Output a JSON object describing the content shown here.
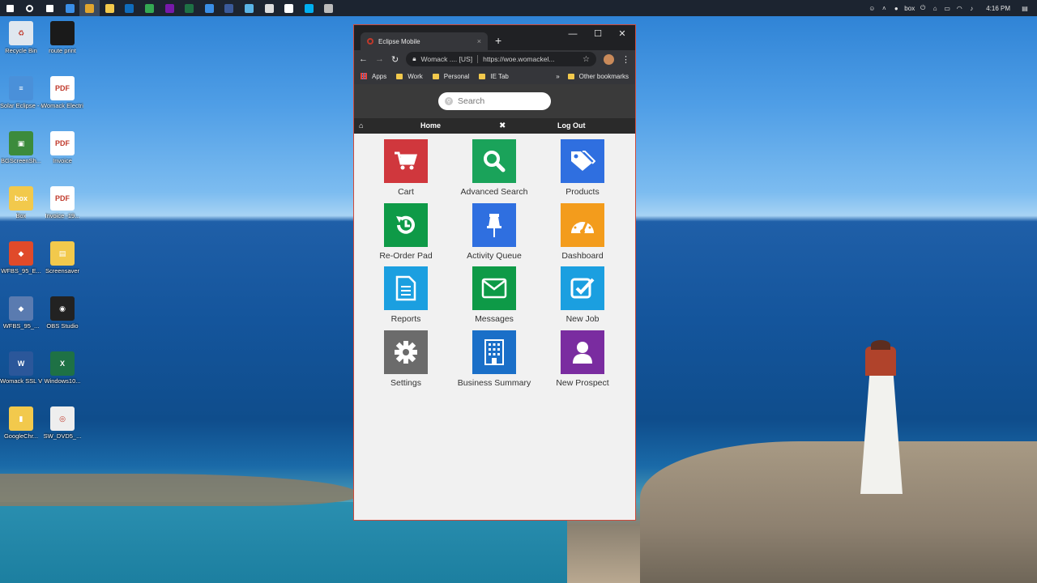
{
  "taskbar": {
    "apps": [
      {
        "icon": "windows-start-icon",
        "color": "#ffffff"
      },
      {
        "icon": "cortana-search-icon",
        "color": "#ffffff"
      },
      {
        "icon": "task-view-icon",
        "color": "#ffffff"
      },
      {
        "icon": "edge-icon",
        "color": "#3a8ee6"
      },
      {
        "icon": "chrome-icon",
        "color": "#e0a52d"
      },
      {
        "icon": "file-explorer-icon",
        "color": "#f2c94c"
      },
      {
        "icon": "outlook-icon",
        "color": "#0f6cbd"
      },
      {
        "icon": "chrome-alt-icon",
        "color": "#34a853"
      },
      {
        "icon": "onenote-icon",
        "color": "#7719aa"
      },
      {
        "icon": "excel-icon",
        "color": "#1e7145"
      },
      {
        "icon": "todo-icon",
        "color": "#3a8ee6"
      },
      {
        "icon": "app-icon",
        "color": "#3a5a9a"
      },
      {
        "icon": "app2-icon",
        "color": "#5ab4e6"
      },
      {
        "icon": "app3-icon",
        "color": "#dddddd"
      },
      {
        "icon": "app4-icon",
        "color": "#ffffff"
      },
      {
        "icon": "skype-icon",
        "color": "#00aff0"
      },
      {
        "icon": "clock-app-icon",
        "color": "#bbbbbb"
      }
    ],
    "tray_clock": "4:16 PM",
    "tray_box": "box"
  },
  "desktop": {
    "icons": [
      {
        "label": "Recycle Bin",
        "color": "#dfe7ef",
        "icon": "recycle-bin-icon"
      },
      {
        "label": "route print",
        "color": "#1a1a1a",
        "icon": "terminal-icon"
      },
      {
        "label": "Solar Eclipse - eclipse",
        "color": "#4a90d9",
        "icon": "eclipse-icon"
      },
      {
        "label": "Womack Electric - Tra...",
        "color": "#ffffff",
        "icon": "pdf-icon"
      },
      {
        "label": "BGScreenSh...",
        "color": "#3c8b3c",
        "icon": "monitor-icon"
      },
      {
        "label": "Invoice",
        "color": "#ffffff",
        "icon": "pdf-icon"
      },
      {
        "label": "Box",
        "color": "#f2c94c",
        "icon": "box-folder-icon"
      },
      {
        "label": "Invoice -19...",
        "color": "#ffffff",
        "icon": "pdf-icon"
      },
      {
        "label": "WFBS_95_E...",
        "color": "#e04a2a",
        "icon": "installer-icon"
      },
      {
        "label": "Screensaver",
        "color": "#f2c94c",
        "icon": "folder-icon"
      },
      {
        "label": "WFBS_95_...",
        "color": "#5a7bb0",
        "icon": "installer-icon"
      },
      {
        "label": "OBS Studio",
        "color": "#222222",
        "icon": "obs-icon"
      },
      {
        "label": "Womack SSL VPN for Users",
        "color": "#2b579a",
        "icon": "word-icon"
      },
      {
        "label": "Windows10...",
        "color": "#1e7145",
        "icon": "excel-icon"
      },
      {
        "label": "GoogleChr...",
        "color": "#f2c94c",
        "icon": "zip-folder-icon"
      },
      {
        "label": "SW_DVD5_...",
        "color": "#eeeeee",
        "icon": "disc-icon"
      }
    ]
  },
  "browser": {
    "tab_title": "Eclipse Mobile",
    "tab_close": "×",
    "new_tab": "+",
    "minimize": "—",
    "maximize": "☐",
    "close": "✕",
    "back": "←",
    "forward": "→",
    "reload": "↻",
    "site_label": "Womack .... [US]",
    "url": "https://woe.womackel...",
    "menu": "⋮",
    "bookmarks": {
      "apps": "Apps",
      "work": "Work",
      "personal": "Personal",
      "ietab": "IE Tab",
      "more": "»",
      "other": "Other bookmarks"
    }
  },
  "page": {
    "search_placeholder": "Search",
    "nav": {
      "home": "Home",
      "logout": "Log Out"
    },
    "tiles": [
      {
        "label": "Cart",
        "color": "#d0373d",
        "icon": "cart-icon"
      },
      {
        "label": "Advanced Search",
        "color": "#1aa35a",
        "icon": "magnifier-icon"
      },
      {
        "label": "Products",
        "color": "#2f6fe0",
        "icon": "tags-icon"
      },
      {
        "label": "Re-Order Pad",
        "color": "#0e9a47",
        "icon": "reorder-icon"
      },
      {
        "label": "Activity Queue",
        "color": "#2f6fe0",
        "icon": "pushpin-icon"
      },
      {
        "label": "Dashboard",
        "color": "#f39c1c",
        "icon": "gauge-icon"
      },
      {
        "label": "Reports",
        "color": "#1b9fe0",
        "icon": "document-icon"
      },
      {
        "label": "Messages",
        "color": "#0e9a47",
        "icon": "envelope-icon"
      },
      {
        "label": "New Job",
        "color": "#1b9fe0",
        "icon": "checkbox-icon"
      },
      {
        "label": "Settings",
        "color": "#6b6b6b",
        "icon": "gear-icon"
      },
      {
        "label": "Business Summary",
        "color": "#1a6fc8",
        "icon": "building-icon"
      },
      {
        "label": "New Prospect",
        "color": "#7a2ca0",
        "icon": "person-icon"
      }
    ]
  }
}
